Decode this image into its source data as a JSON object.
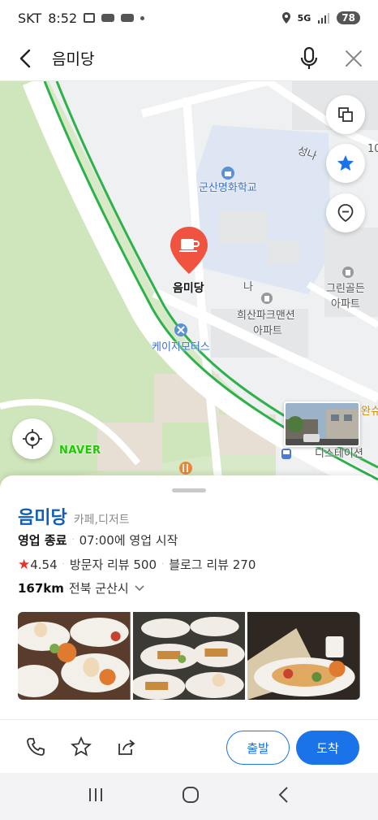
{
  "status_bar": {
    "carrier": "SKT",
    "time": "8:52",
    "network": "5G",
    "battery": "78"
  },
  "search": {
    "query": "음미당"
  },
  "map": {
    "labels": {
      "school": "군산명화학교",
      "apartment1_line1": "희산파크맨션",
      "apartment1_line2": "아파트",
      "apartment2_line1": "그린골든",
      "apartment2_line2": "아파트",
      "motors": "케이지모터스",
      "station": "디스테이션",
      "street": "성나",
      "na": "나",
      "cut_right": "완슈",
      "num": "10"
    },
    "pin_label": "음미당",
    "brand": "NAVER",
    "colors": {
      "pin": "#f0533f",
      "accent": "#1a73e8",
      "route": "#2db24a"
    }
  },
  "place": {
    "name": "음미당",
    "category": "카페,디저트",
    "status": "영업 종료",
    "next_open": "07:00에 영업 시작",
    "rating": "4.54",
    "visitor_reviews": "방문자 리뷰 500",
    "blog_reviews": "블로그 리뷰 270",
    "distance": "167km",
    "region": "전북 군산시"
  },
  "actions": {
    "depart": "출발",
    "arrive": "도착"
  },
  "icons": [
    "back-arrow-icon",
    "mic-icon",
    "close-icon",
    "layers-icon",
    "star-icon",
    "pin-outline-icon",
    "locate-icon",
    "phone-icon",
    "bookmark-star-icon",
    "share-icon",
    "chevron-down-icon",
    "recent-apps-icon",
    "home-icon",
    "back-icon"
  ]
}
